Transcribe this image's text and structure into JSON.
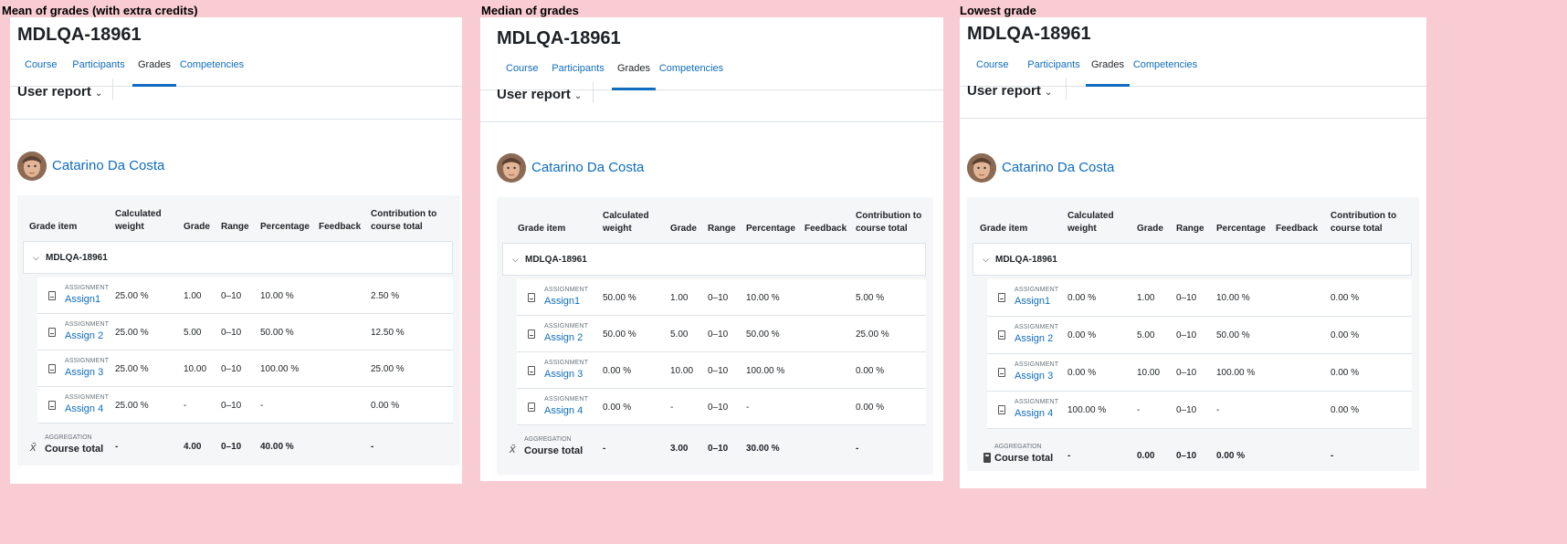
{
  "panels": [
    {
      "caption": "Mean of grades (with extra credits)",
      "course": "MDLQA-18961",
      "tabs": [
        "Course",
        "Participants",
        "Grades",
        "Competencies"
      ],
      "report_label": "User report",
      "user_name": "Catarino Da Costa",
      "headers": {
        "grade_item": "Grade item",
        "calc_weight": "Calculated weight",
        "grade": "Grade",
        "range": "Range",
        "percentage": "Percentage",
        "feedback": "Feedback",
        "contribution": "Contribution to course total"
      },
      "category": "MDLQA-18961",
      "items": [
        {
          "type": "ASSIGNMENT",
          "name": "Assign1",
          "weight": "25.00 %",
          "grade": "1.00",
          "range": "0–10",
          "percentage": "10.00 %",
          "contribution": "2.50 %"
        },
        {
          "type": "ASSIGNMENT",
          "name": "Assign 2",
          "weight": "25.00 %",
          "grade": "5.00",
          "range": "0–10",
          "percentage": "50.00 %",
          "contribution": "12.50 %"
        },
        {
          "type": "ASSIGNMENT",
          "name": "Assign 3",
          "weight": "25.00 %",
          "grade": "10.00",
          "range": "0–10",
          "percentage": "100.00 %",
          "contribution": "25.00 %"
        },
        {
          "type": "ASSIGNMENT",
          "name": "Assign 4",
          "weight": "25.00 %",
          "grade": "-",
          "range": "0–10",
          "percentage": "-",
          "contribution": "0.00 %"
        }
      ],
      "total": {
        "type": "AGGREGATION",
        "label": "Course total",
        "icon": "aggregation-mean-icon",
        "weight": "-",
        "grade": "4.00",
        "range": "0–10",
        "percentage": "40.00 %",
        "contribution": "-"
      }
    },
    {
      "caption": "Median of grades",
      "course": "MDLQA-18961",
      "tabs": [
        "Course",
        "Participants",
        "Grades",
        "Competencies"
      ],
      "report_label": "User report",
      "user_name": "Catarino Da Costa",
      "headers": {
        "grade_item": "Grade item",
        "calc_weight": "Calculated weight",
        "grade": "Grade",
        "range": "Range",
        "percentage": "Percentage",
        "feedback": "Feedback",
        "contribution": "Contribution to course total"
      },
      "category": "MDLQA-18961",
      "items": [
        {
          "type": "ASSIGNMENT",
          "name": "Assign1",
          "weight": "50.00 %",
          "grade": "1.00",
          "range": "0–10",
          "percentage": "10.00 %",
          "contribution": "5.00 %"
        },
        {
          "type": "ASSIGNMENT",
          "name": "Assign 2",
          "weight": "50.00 %",
          "grade": "5.00",
          "range": "0–10",
          "percentage": "50.00 %",
          "contribution": "25.00 %"
        },
        {
          "type": "ASSIGNMENT",
          "name": "Assign 3",
          "weight": "0.00 %",
          "grade": "10.00",
          "range": "0–10",
          "percentage": "100.00 %",
          "contribution": "0.00 %"
        },
        {
          "type": "ASSIGNMENT",
          "name": "Assign 4",
          "weight": "0.00 %",
          "grade": "-",
          "range": "0–10",
          "percentage": "-",
          "contribution": "0.00 %"
        }
      ],
      "total": {
        "type": "AGGREGATION",
        "label": "Course total",
        "icon": "aggregation-mean-icon",
        "weight": "-",
        "grade": "3.00",
        "range": "0–10",
        "percentage": "30.00 %",
        "contribution": "-"
      }
    },
    {
      "caption": "Lowest grade",
      "course": "MDLQA-18961",
      "tabs": [
        "Course",
        "Participants",
        "Grades",
        "Competencies"
      ],
      "report_label": "User report",
      "user_name": "Catarino Da Costa",
      "headers": {
        "grade_item": "Grade item",
        "calc_weight": "Calculated weight",
        "grade": "Grade",
        "range": "Range",
        "percentage": "Percentage",
        "feedback": "Feedback",
        "contribution": "Contribution to course total"
      },
      "category": "MDLQA-18961",
      "items": [
        {
          "type": "ASSIGNMENT",
          "name": "Assign1",
          "weight": "0.00 %",
          "grade": "1.00",
          "range": "0–10",
          "percentage": "10.00 %",
          "contribution": "0.00 %"
        },
        {
          "type": "ASSIGNMENT",
          "name": "Assign 2",
          "weight": "0.00 %",
          "grade": "5.00",
          "range": "0–10",
          "percentage": "50.00 %",
          "contribution": "0.00 %"
        },
        {
          "type": "ASSIGNMENT",
          "name": "Assign 3",
          "weight": "0.00 %",
          "grade": "10.00",
          "range": "0–10",
          "percentage": "100.00 %",
          "contribution": "0.00 %"
        },
        {
          "type": "ASSIGNMENT",
          "name": "Assign 4",
          "weight": "100.00 %",
          "grade": "-",
          "range": "0–10",
          "percentage": "-",
          "contribution": "0.00 %"
        }
      ],
      "total": {
        "type": "AGGREGATION",
        "label": "Course total",
        "icon": "calculator-icon",
        "weight": "-",
        "grade": "0.00",
        "range": "0–10",
        "percentage": "0.00 %",
        "contribution": "-"
      }
    }
  ],
  "colors": {
    "background": "#f9ccd3",
    "link": "#0f6cbf",
    "text": "#1d2125",
    "table_bg": "#f5f6f8"
  }
}
